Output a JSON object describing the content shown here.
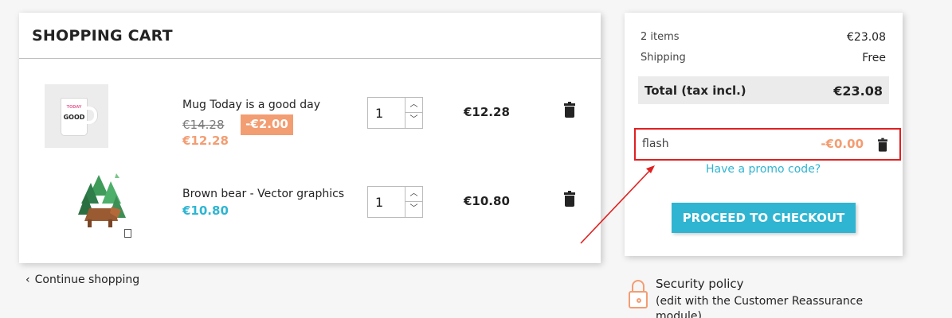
{
  "cart": {
    "title": "SHOPPING CART",
    "items": [
      {
        "name": "Mug Today is a good day",
        "old_price": "€14.28",
        "discount": "-€2.00",
        "price": "€12.28",
        "quantity": "1",
        "total": "€12.28",
        "image_text_top": "TODAY",
        "image_text_main": "GOOD"
      },
      {
        "name": "Brown bear - Vector graphics",
        "price": "€10.80",
        "quantity": "1",
        "total": "€10.80"
      }
    ],
    "continue_label": "Continue shopping"
  },
  "summary": {
    "items_label": "2 items",
    "items_value": "€23.08",
    "shipping_label": "Shipping",
    "shipping_value": "Free",
    "total_label": "Total (tax incl.)",
    "total_value": "€23.08",
    "voucher": {
      "code": "flash",
      "amount": "-€0.00"
    },
    "promo_link": "Have a promo code?",
    "checkout_label": "PROCEED TO CHECKOUT"
  },
  "reassurance": {
    "title": "Security policy",
    "description": "(edit with the Customer Reassurance module)"
  },
  "colors": {
    "accent_blue": "#2fb5d2",
    "accent_orange": "#f39d72",
    "highlight_red": "#e02020"
  },
  "icons": {
    "trash": "trash-icon",
    "lock": "lock-icon",
    "chevron": "chevron-left-icon"
  }
}
